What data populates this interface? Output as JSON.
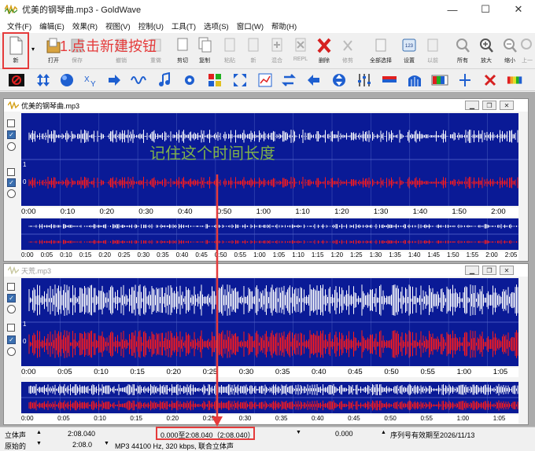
{
  "app": {
    "title": "优美的钢琴曲.mp3 - GoldWave",
    "window_controls": {
      "min": "—",
      "max": "☐",
      "close": "✕"
    }
  },
  "menu": [
    "文件(F)",
    "编辑(E)",
    "效果(R)",
    "视图(V)",
    "控制(U)",
    "工具(T)",
    "选项(S)",
    "窗口(W)",
    "帮助(H)"
  ],
  "toolbar": {
    "new_label": "新",
    "open_label": "打开",
    "save_label": "保存",
    "undo_label": "撤销",
    "redo_label": "重做",
    "cut_label": "剪切",
    "copy_label": "复制",
    "paste_label": "粘贴",
    "new2_label": "新",
    "mix_label": "混合",
    "repl_label": "REPL",
    "delete_label": "删除",
    "trim_label": "修剪",
    "selectall_label": "全部选择",
    "settings_label": "设置",
    "previous_label": "以前",
    "all_label": "所有",
    "zoomin_label": "放大",
    "zoomout_label": "缩小",
    "up_label": "上一"
  },
  "annotations": {
    "new_button_hint": "1.点击新建按钮",
    "remember_duration": "记住这个时间长度"
  },
  "windows": [
    {
      "title": "优美的钢琴曲.mp3",
      "ticks": [
        "0:00",
        "0:10",
        "0:20",
        "0:30",
        "0:40",
        "0:50",
        "1:00",
        "1:10",
        "1:20",
        "1:30",
        "1:40",
        "1:50",
        "2:00"
      ],
      "overview_ticks": [
        "0:00",
        "0:05",
        "0:10",
        "0:15",
        "0:20",
        "0:25",
        "0:30",
        "0:35",
        "0:40",
        "0:45",
        "0:50",
        "0:55",
        "1:00",
        "1:05",
        "1:10",
        "1:15",
        "1:20",
        "1:25",
        "1:30",
        "1:35",
        "1:40",
        "1:45",
        "1:50",
        "1:55",
        "2:00",
        "2:05"
      ],
      "channel_marks": {
        "top": "1",
        "zero": "0"
      }
    },
    {
      "title": "天荒.mp3",
      "ticks": [
        "0:00",
        "0:05",
        "0:10",
        "0:15",
        "0:20",
        "0:25",
        "0:30",
        "0:35",
        "0:40",
        "0:45",
        "0:50",
        "0:55",
        "1:00",
        "1:05"
      ],
      "overview_ticks": [
        "0:00",
        "0:05",
        "0:10",
        "0:15",
        "0:20",
        "0:25",
        "0:30",
        "0:35",
        "0:40",
        "0:45",
        "0:50",
        "0:55",
        "1:00",
        "1:05"
      ],
      "channel_marks": {
        "top": "1",
        "zero": "0"
      }
    }
  ],
  "status": {
    "channel_mode": "立体声",
    "length": "2:08.040",
    "selection": "0.000至2:08.040（2:08.040）",
    "position": "0.000",
    "license": "序列号有效期至2026/11/13",
    "original": "原始的",
    "original_val": "2:08.0",
    "format": "MP3 44100 Hz, 320 kbps, 联合立体声"
  }
}
